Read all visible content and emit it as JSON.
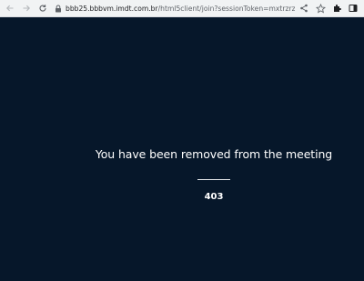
{
  "browser": {
    "url_host": "bbb25.bbbvm.imdt.com.br",
    "url_path": "/html5client/join?sessionToken=mxtrzrza49cyvcmg"
  },
  "page": {
    "message": "You have been removed from the meeting",
    "error_code": "403",
    "background_color": "#06172a"
  }
}
